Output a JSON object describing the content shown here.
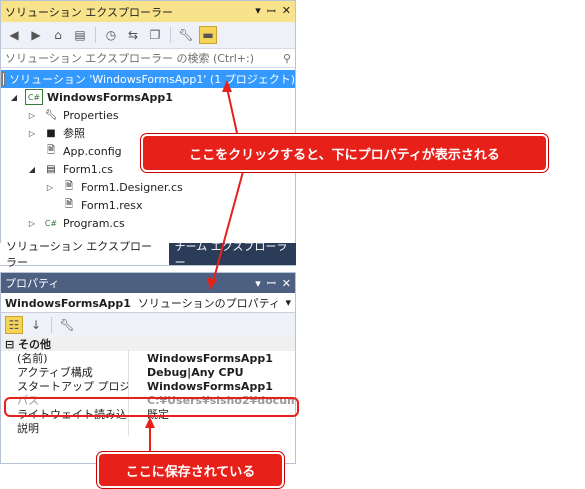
{
  "solution_explorer": {
    "title": "ソリューション エクスプローラー",
    "title_buttons": [
      "▾",
      "ᚔ",
      "✕"
    ],
    "search_placeholder": "ソリューション エクスプローラー の検索 (Ctrl+:)",
    "tree": [
      {
        "label": "ソリューション 'WindowsFormsApp1' (1 プロジェクト)",
        "icon": "solution-icon",
        "selected": true
      },
      {
        "label": "WindowsFormsApp1",
        "icon": "csharp-project-icon",
        "bold": true
      },
      {
        "label": "Properties",
        "icon": "wrench-icon"
      },
      {
        "label": "参照",
        "icon": "references-icon"
      },
      {
        "label": "App.config",
        "icon": "config-file-icon"
      },
      {
        "label": "Form1.cs",
        "icon": "form-icon"
      },
      {
        "label": "Form1.Designer.cs",
        "icon": "cs-file-icon"
      },
      {
        "label": "Form1.resx",
        "icon": "resx-file-icon"
      },
      {
        "label": "Program.cs",
        "icon": "csharp-file-icon"
      }
    ],
    "tabs": [
      "ソリューション エクスプローラー",
      "チーム エクスプローラー"
    ]
  },
  "properties": {
    "title": "プロパティ",
    "object_name": "WindowsFormsApp1",
    "object_type": "ソリューションのプロパティ",
    "category": "その他",
    "rows": [
      {
        "name": "(名前)",
        "value": "WindowsFormsApp1"
      },
      {
        "name": "アクティブ構成",
        "value": "Debug|Any CPU"
      },
      {
        "name": "スタートアップ プロジェクト",
        "value": "WindowsFormsApp1"
      },
      {
        "name": "パス",
        "value": "C:¥Users¥sisho2¥documen"
      },
      {
        "name": "ライトウェイト読み込み",
        "value": "既定"
      },
      {
        "name": "説明",
        "value": ""
      }
    ]
  },
  "annotations": {
    "top_callout": "ここをクリックすると、下にプロパティが表示される",
    "bottom_callout": "ここに保存されている"
  },
  "colors": {
    "accent": "#e8201a",
    "selection": "#3399ff",
    "titlebar": "#f8e38a"
  }
}
